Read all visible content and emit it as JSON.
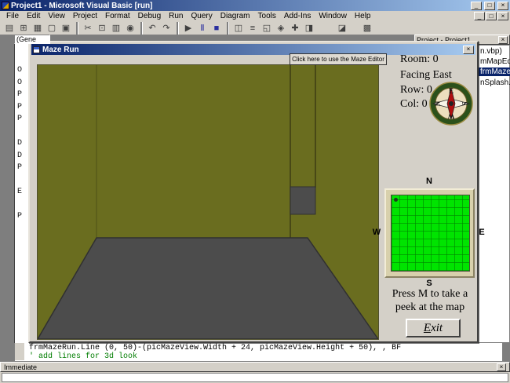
{
  "colors": {
    "titlebar_start": "#0a246a",
    "titlebar_end": "#a6caf0",
    "chrome": "#d4d0c8",
    "mdi_bg": "#7e7e7e",
    "wall_olive": "#6a6d1f",
    "floor_gray": "#4c4c4c",
    "map_green": "#00e400",
    "map_frame": "#d8d0ac",
    "selection_blue": "#0a246a"
  },
  "window_controls": {
    "minimize": "_",
    "maximize": "□",
    "close": "×"
  },
  "titlebar": {
    "title": "Project1 - Microsoft Visual Basic [run]"
  },
  "menu": {
    "items": [
      "File",
      "Edit",
      "View",
      "Project",
      "Format",
      "Debug",
      "Run",
      "Query",
      "Diagram",
      "Tools",
      "Add-Ins",
      "Window",
      "Help"
    ]
  },
  "toolbar": {
    "icons": [
      {
        "name": "add-project-button",
        "glyph": "▤"
      },
      {
        "name": "add-form-button",
        "glyph": "⊞"
      },
      {
        "name": "menu-editor-button",
        "glyph": "▦"
      },
      {
        "name": "open-project-button",
        "glyph": "▢"
      },
      {
        "name": "save-project-button",
        "glyph": "▣"
      },
      {
        "name": "cut-button",
        "glyph": "✂"
      },
      {
        "name": "copy-button",
        "glyph": "⊡"
      },
      {
        "name": "paste-button",
        "glyph": "▥"
      },
      {
        "name": "find-button",
        "glyph": "◉"
      },
      {
        "name": "undo-button",
        "glyph": "↶"
      },
      {
        "name": "redo-button",
        "glyph": "↷"
      },
      {
        "name": "start-button",
        "glyph": "▶"
      },
      {
        "name": "break-button",
        "glyph": "Ⅱ"
      },
      {
        "name": "end-button",
        "glyph": "■"
      },
      {
        "name": "project-explorer-button",
        "glyph": "◫"
      },
      {
        "name": "properties-window-button",
        "glyph": "≡"
      },
      {
        "name": "form-layout-button",
        "glyph": "◱"
      },
      {
        "name": "object-browser-button",
        "glyph": "◈"
      },
      {
        "name": "toolbox-button",
        "glyph": "✚"
      },
      {
        "name": "data-view-button",
        "glyph": "◨"
      },
      {
        "name": "component-button",
        "glyph": "◪"
      },
      {
        "name": "table-button",
        "glyph": "▩"
      }
    ]
  },
  "code_combo": {
    "label": "(Gene"
  },
  "code_strip": {
    "letters": "O\nO\nP\nP\nP\n\nD\nD\nP\n\nE\n\nP"
  },
  "code_window": {
    "line1": "frmMazeRun.Line (0, 50)-(picMazeView.Width + 24, picMazeView.Height + 50), , BF",
    "line2": "' add lines for 3d look"
  },
  "immediate": {
    "title": "Immediate"
  },
  "project_panel": {
    "title": "Project - Project1",
    "root_partial": "n.vbp)",
    "item1": "mMapEdit",
    "item2": "frmMazeR",
    "item3": "nSplash.frm"
  },
  "maze_window": {
    "title": "Maze Run",
    "editor_button": "Click here to use the Maze Editor",
    "stats": {
      "room": "Room: 0",
      "facing": "Facing East",
      "row": "Row: 0",
      "col": "Col: 0"
    },
    "compass": {
      "top": "E",
      "right": "S",
      "bottom": "W",
      "left": "N"
    },
    "map": {
      "north": "N",
      "south": "S",
      "east": "E",
      "west": "W"
    },
    "hint_line1": "Press M to take a",
    "hint_line2": "peek at the map",
    "exit_accel": "E",
    "exit_rest": "xit"
  }
}
